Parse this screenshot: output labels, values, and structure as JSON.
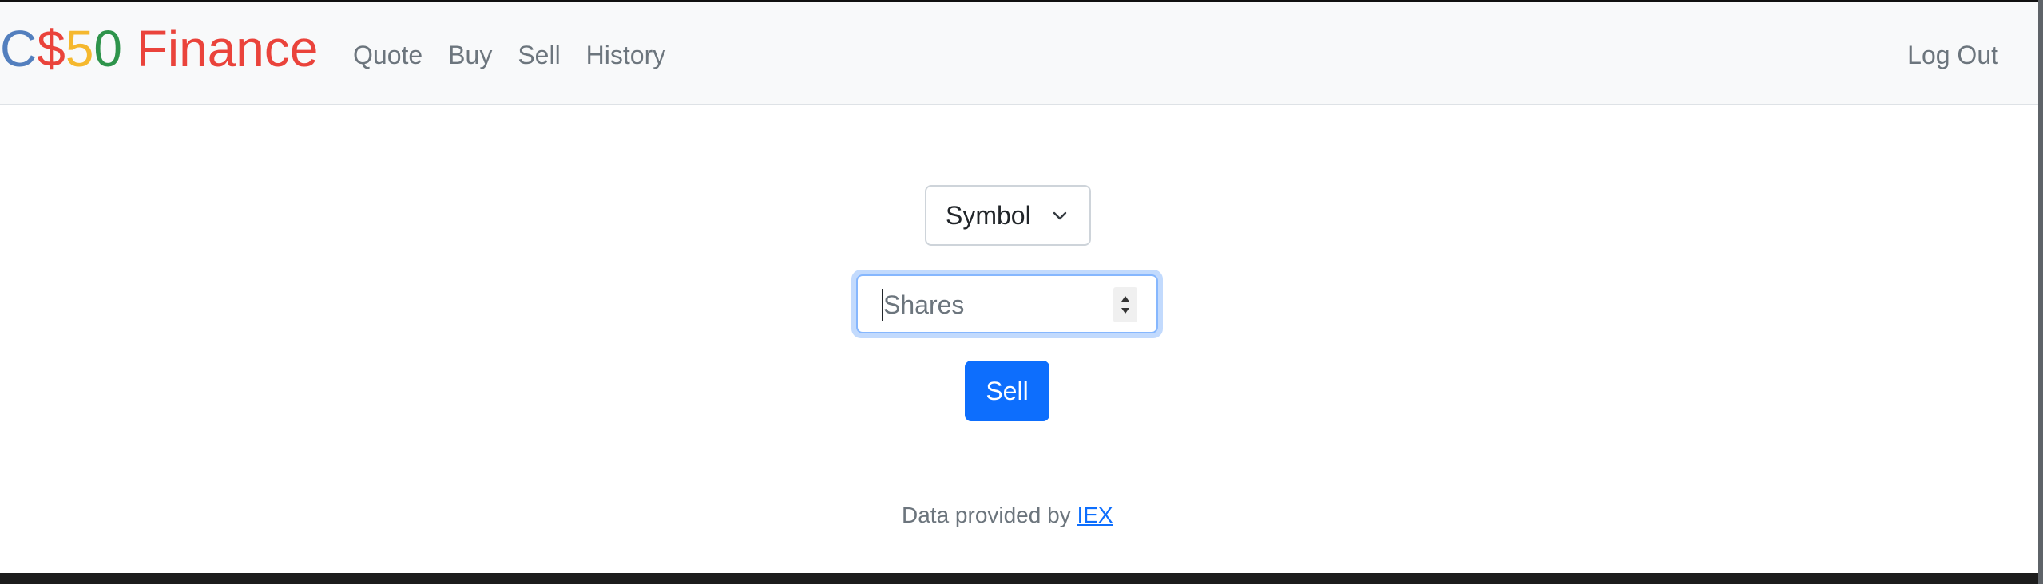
{
  "brand": {
    "parts": [
      {
        "text": "C",
        "color": "#537fbe"
      },
      {
        "text": "$",
        "color": "#ea433b"
      },
      {
        "text": "5",
        "color": "#f5b82e"
      },
      {
        "text": "0",
        "color": "#2e944b"
      },
      {
        "text": " Finance",
        "color": "#ea433b"
      }
    ]
  },
  "nav": {
    "items": [
      {
        "label": "Quote"
      },
      {
        "label": "Buy"
      },
      {
        "label": "Sell"
      },
      {
        "label": "History"
      }
    ],
    "logout_label": "Log Out"
  },
  "form": {
    "symbol_select": {
      "selected": "Symbol",
      "icon": "chevron-down-icon"
    },
    "shares_input": {
      "placeholder": "Shares",
      "value": "",
      "focused": true,
      "icon": "number-spinner-icon"
    },
    "submit_label": "Sell"
  },
  "footer": {
    "text": "Data provided by ",
    "link_label": "IEX"
  },
  "colors": {
    "primary": "#0d6efd",
    "navbar_bg": "#f8f9fa",
    "muted_text": "#6c757d",
    "focus_ring": "#c2dafd"
  }
}
